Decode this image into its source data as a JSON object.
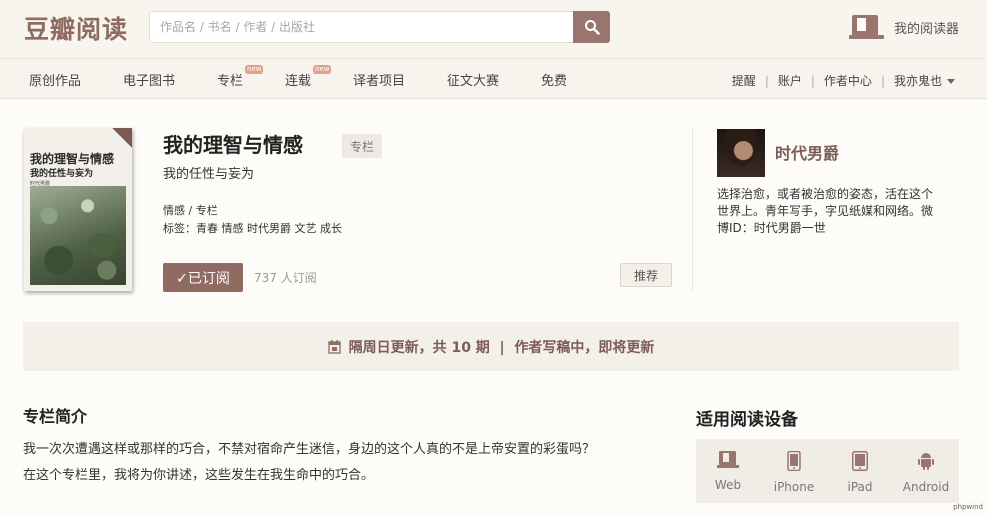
{
  "header": {
    "logo": "豆瓣阅读",
    "search_placeholder": "作品名 / 书名 / 作者 / 出版社",
    "reader_label": "我的阅读器"
  },
  "nav": {
    "items": [
      "原创作品",
      "电子图书",
      "专栏",
      "连载",
      "译者项目",
      "征文大赛",
      "免费"
    ],
    "new_badge": "new",
    "right": [
      "提醒",
      "账户",
      "作者中心",
      "我亦鬼也"
    ],
    "separator": "|"
  },
  "book": {
    "cover_title": "我的理智与情感",
    "cover_subtitle": "我的任性与妄为",
    "cover_author": "时代男爵",
    "title": "我的理智与情感",
    "type_tag": "专栏",
    "subtitle": "我的任性与妄为",
    "category": "情感 / 专栏",
    "tags": "标签：青春 情感 时代男爵 文艺 成长",
    "subscribe_label": "✓已订阅",
    "subscribers": "737 人订阅",
    "recommend_label": "推荐"
  },
  "author": {
    "name": "时代男爵",
    "bio": "选择治愈，或者被治愈的姿态，活在这个世界上。青年写手，字见纸媒和网络。微博ID：时代男爵一世"
  },
  "update": {
    "text": "隔周日更新，共 10 期  |  作者写稿中，即将更新"
  },
  "intro": {
    "title": "专栏简介",
    "line1": "我一次次遭遇这样或那样的巧合，不禁对宿命产生迷信，身边的这个人真的不是上帝安置的彩蛋吗？",
    "line2": "在这个专栏里，我将为你讲述，这些发生在我生命中的巧合。"
  },
  "devices": {
    "title": "适用阅读设备",
    "items": [
      "Web",
      "iPhone",
      "iPad",
      "Android"
    ]
  },
  "watermark": "phpwind",
  "colors": {
    "accent": "#8f6b61",
    "button_bg": "#9a7570"
  }
}
